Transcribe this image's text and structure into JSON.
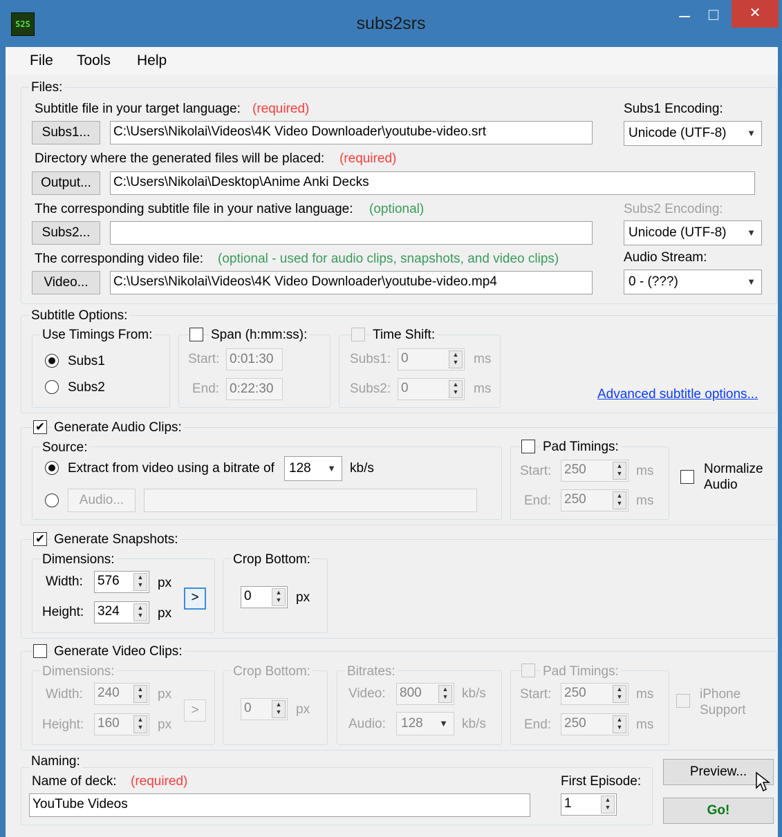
{
  "window": {
    "title": "subs2srs",
    "icon_text": "S2S",
    "minimize_glyph": "–",
    "maximize_glyph": "☐",
    "close_glyph": "✕"
  },
  "menu": [
    "File",
    "Tools",
    "Help"
  ],
  "files": {
    "legend": "Files:",
    "subs1_label": "Subtitle file in your target language:",
    "subs1_req": "(required)",
    "subs1_button": "Subs1...",
    "subs1_path": "C:\\Users\\Nikolai\\Videos\\4K Video Downloader\\youtube-video.srt",
    "subs1_encoding_label": "Subs1 Encoding:",
    "subs1_encoding": "Unicode (UTF-8)",
    "output_label": "Directory where the generated files will be placed:",
    "output_req": "(required)",
    "output_button": "Output...",
    "output_path": "C:\\Users\\Nikolai\\Desktop\\Anime Anki Decks",
    "subs2_label": "The corresponding subtitle file in your native language:",
    "subs2_opt": "(optional)",
    "subs2_button": "Subs2...",
    "subs2_path": "",
    "subs2_encoding_label": "Subs2 Encoding:",
    "subs2_encoding": "Unicode (UTF-8)",
    "video_label": "The corresponding video file:",
    "video_opt": "(optional - used for audio clips, snapshots, and video clips)",
    "video_button": "Video...",
    "video_path": "C:\\Users\\Nikolai\\Videos\\4K Video Downloader\\youtube-video.mp4",
    "audio_stream_label": "Audio Stream:",
    "audio_stream": "0 - (???)"
  },
  "subtitle_options": {
    "legend": "Subtitle Options:",
    "use_timings_legend": "Use Timings From:",
    "subs1": "Subs1",
    "subs2": "Subs2",
    "span_legend": "Span (h:mm:ss):",
    "start_label": "Start:",
    "start_value": "0:01:30",
    "end_label": "End:",
    "end_value": "0:22:30",
    "timeshift_legend": "Time Shift:",
    "ts_subs1_label": "Subs1:",
    "ts_subs1_value": "0",
    "ts_subs2_label": "Subs2:",
    "ts_subs2_value": "0",
    "ms": "ms",
    "advanced_link": "Advanced subtitle options..."
  },
  "audio": {
    "legend": "Generate Audio Clips:",
    "source_legend": "Source:",
    "extract_label": "Extract from video using a bitrate of",
    "bitrate": "128",
    "kbs": "kb/s",
    "audio_button": "Audio...",
    "pad_legend": "Pad Timings:",
    "start_label": "Start:",
    "start_value": "250",
    "end_label": "End:",
    "end_value": "250",
    "ms": "ms",
    "normalize_line1": "Normalize",
    "normalize_line2": "Audio"
  },
  "snapshots": {
    "legend": "Generate Snapshots:",
    "dimensions_legend": "Dimensions:",
    "width_label": "Width:",
    "width_value": "576",
    "height_label": "Height:",
    "height_value": "324",
    "px": "px",
    "arrow_button": ">",
    "crop_legend": "Crop Bottom:",
    "crop_value": "0"
  },
  "video_clips": {
    "legend": "Generate Video Clips:",
    "dimensions_legend": "Dimensions:",
    "width_label": "Width:",
    "width_value": "240",
    "height_label": "Height:",
    "height_value": "160",
    "px": "px",
    "arrow_button": ">",
    "crop_legend": "Crop Bottom:",
    "crop_value": "0",
    "bitrates_legend": "Bitrates:",
    "video_label": "Video:",
    "video_value": "800",
    "audio_label": "Audio:",
    "audio_value": "128",
    "kbs": "kb/s",
    "pad_legend": "Pad Timings:",
    "start_label": "Start:",
    "start_value": "250",
    "end_label": "End:",
    "end_value": "250",
    "ms": "ms",
    "iphone_line1": "iPhone",
    "iphone_line2": "Support"
  },
  "naming": {
    "legend": "Naming:",
    "deck_label": "Name of deck:",
    "deck_req": "(required)",
    "deck_value": "YouTube Videos",
    "first_episode_label": "First Episode:",
    "first_episode_value": "1"
  },
  "actions": {
    "preview": "Preview...",
    "go": "Go!"
  }
}
